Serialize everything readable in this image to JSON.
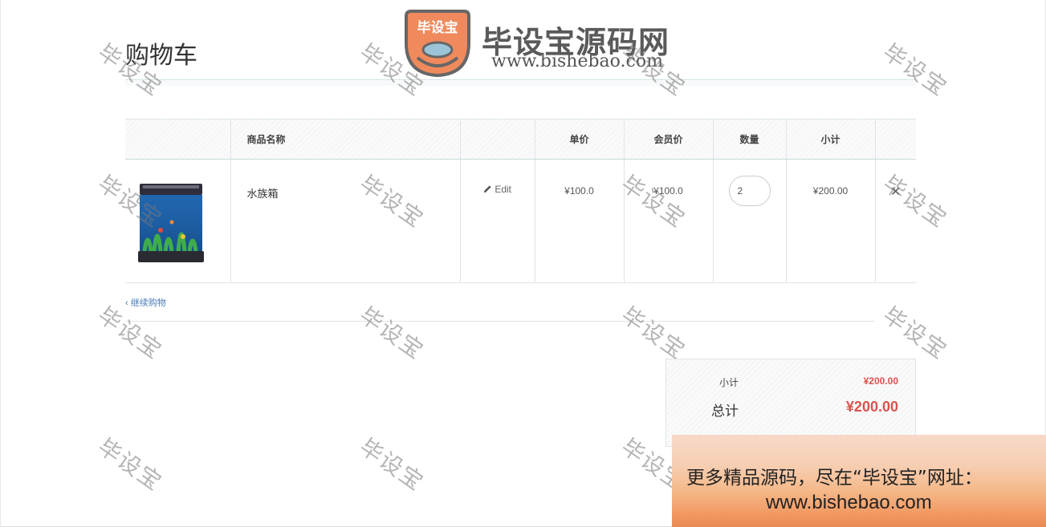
{
  "page": {
    "title": "购物车"
  },
  "logo": {
    "badge_text": "毕设宝",
    "name": "毕设宝源码网",
    "url": "www.bishebao.com"
  },
  "table": {
    "headers": [
      "商品名称",
      "单价",
      "会员价",
      "数量",
      "小计"
    ],
    "rows": [
      {
        "name": "水族箱",
        "edit_label": "Edit",
        "price": "¥100.0",
        "member_price": "¥100.0",
        "qty": "2",
        "subtotal": "¥200.00",
        "remove_icon": "close-icon"
      }
    ]
  },
  "continue_link": "继续购物",
  "totals": {
    "subtotal_label": "小计",
    "subtotal_value": "¥200.00",
    "total_label": "总计",
    "total_value": "¥200.00"
  },
  "watermark": "毕设宝",
  "banner": {
    "line1": "更多精品源码，尽在“毕设宝”网址：",
    "line2": "www.bishebao.com"
  },
  "colors": {
    "price_red": "#d9534f",
    "link_blue": "#4a7bb5",
    "logo_orange": "#f08a5d"
  }
}
